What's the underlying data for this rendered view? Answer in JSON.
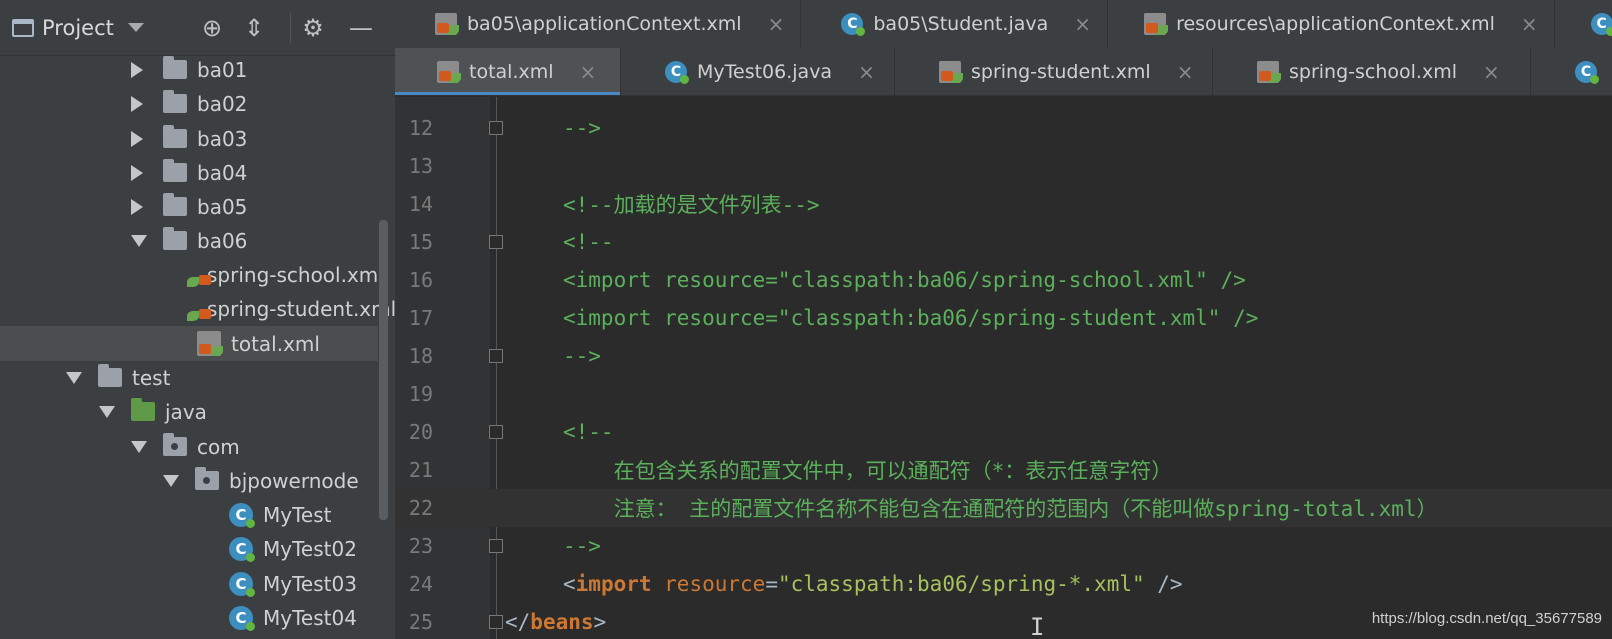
{
  "project": {
    "title": "Project",
    "tree": [
      {
        "label": "ba01",
        "type": "folder",
        "state": "collapsed"
      },
      {
        "label": "ba02",
        "type": "folder",
        "state": "collapsed"
      },
      {
        "label": "ba03",
        "type": "folder",
        "state": "collapsed"
      },
      {
        "label": "ba04",
        "type": "folder",
        "state": "collapsed"
      },
      {
        "label": "ba05",
        "type": "folder",
        "state": "collapsed"
      },
      {
        "label": "ba06",
        "type": "folder",
        "state": "expanded"
      },
      {
        "label": "spring-school.xml",
        "type": "xml"
      },
      {
        "label": "spring-student.xml",
        "type": "xml"
      },
      {
        "label": "total.xml",
        "type": "xml",
        "selected": true
      },
      {
        "label": "test",
        "type": "folder",
        "state": "expanded"
      },
      {
        "label": "java",
        "type": "src-folder",
        "state": "expanded"
      },
      {
        "label": "com",
        "type": "package",
        "state": "expanded"
      },
      {
        "label": "bjpowernode",
        "type": "package",
        "state": "expanded"
      },
      {
        "label": "MyTest",
        "type": "class"
      },
      {
        "label": "MyTest02",
        "type": "class"
      },
      {
        "label": "MyTest03",
        "type": "class"
      },
      {
        "label": "MyTest04",
        "type": "class"
      }
    ]
  },
  "tabs_row1": [
    {
      "label": "ba05\\applicationContext.xml",
      "icon": "xml-file-icon"
    },
    {
      "label": "ba05\\Student.java",
      "icon": "java-class-icon"
    },
    {
      "label": "resources\\applicationContext.xml",
      "icon": "xml-file-icon"
    }
  ],
  "tabs_row2": [
    {
      "label": "total.xml",
      "icon": "xml-file-icon",
      "active": true
    },
    {
      "label": "MyTest06.java",
      "icon": "java-class-icon"
    },
    {
      "label": "spring-student.xml",
      "icon": "xml-file-icon"
    },
    {
      "label": "spring-school.xml",
      "icon": "xml-file-icon"
    }
  ],
  "close_glyph": "×",
  "code": {
    "line_numbers": [
      "12",
      "13",
      "14",
      "15",
      "16",
      "17",
      "18",
      "19",
      "20",
      "21",
      "22",
      "23",
      "24",
      "25"
    ],
    "l12": "-->",
    "l14": "<!--加载的是文件列表-->",
    "l15": "<!--",
    "l16": "<import resource=\"classpath:ba06/spring-school.xml\" />",
    "l17": "<import resource=\"classpath:ba06/spring-student.xml\" />",
    "l18": "-->",
    "l20": "<!--",
    "l21": "    在包含关系的配置文件中，可以通配符（*：表示任意字符）",
    "l22": "    注意： 主的配置文件名称不能包含在通配符的范围内（不能叫做spring-total.xml）",
    "l23": "-->",
    "l24": {
      "open": "<",
      "tag": "import",
      "attr": " resource",
      "eq": "=",
      "val": "\"classpath:ba06/spring-*.xml\"",
      "close": " />"
    },
    "l25": {
      "open": "</",
      "tag": "beans",
      "close": ">"
    }
  },
  "watermark": "https://blog.csdn.net/qq_35677589",
  "colors": {
    "accent": "#4a88c7",
    "comment": "#5bb05b",
    "keyword": "#cc7832",
    "string": "#a5c25c"
  }
}
